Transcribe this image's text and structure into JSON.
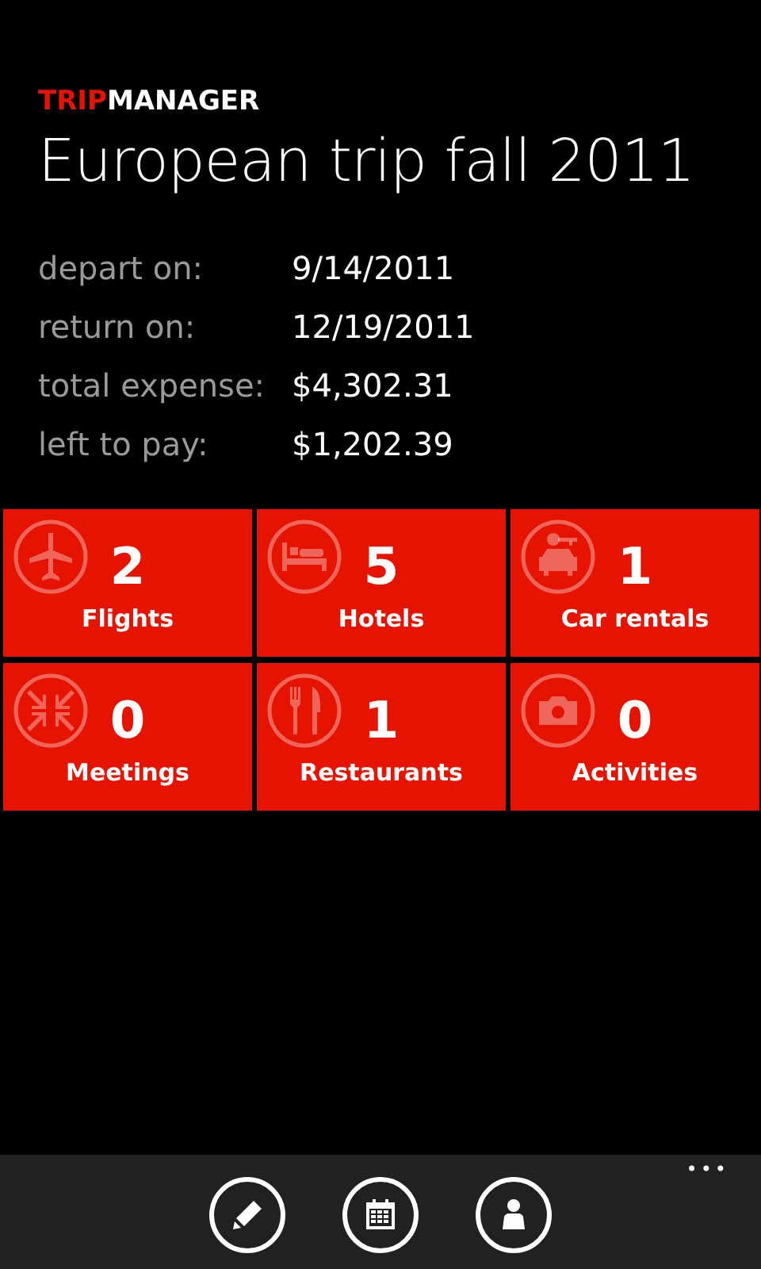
{
  "app_logo": {
    "accent": "TRIP",
    "rest": "MANAGER"
  },
  "title": "European trip fall 2011",
  "details": [
    {
      "label": "depart on:",
      "value": "9/14/2011"
    },
    {
      "label": "return on:",
      "value": "12/19/2011"
    },
    {
      "label": "total expense:",
      "value": "$4,302.31"
    },
    {
      "label": "left to pay:",
      "value": "$1,202.39"
    }
  ],
  "tiles": [
    {
      "kind": "flights",
      "count": "2",
      "label": "Flights"
    },
    {
      "kind": "hotels",
      "count": "5",
      "label": "Hotels"
    },
    {
      "kind": "cars",
      "count": "1",
      "label": "Car rentals"
    },
    {
      "kind": "meetings",
      "count": "0",
      "label": "Meetings"
    },
    {
      "kind": "restaurants",
      "count": "1",
      "label": "Restaurants"
    },
    {
      "kind": "activities",
      "count": "0",
      "label": "Activities"
    }
  ],
  "app_bar": {
    "buttons": [
      {
        "kind": "edit"
      },
      {
        "kind": "calendar"
      },
      {
        "kind": "person"
      }
    ],
    "more": "•••"
  }
}
